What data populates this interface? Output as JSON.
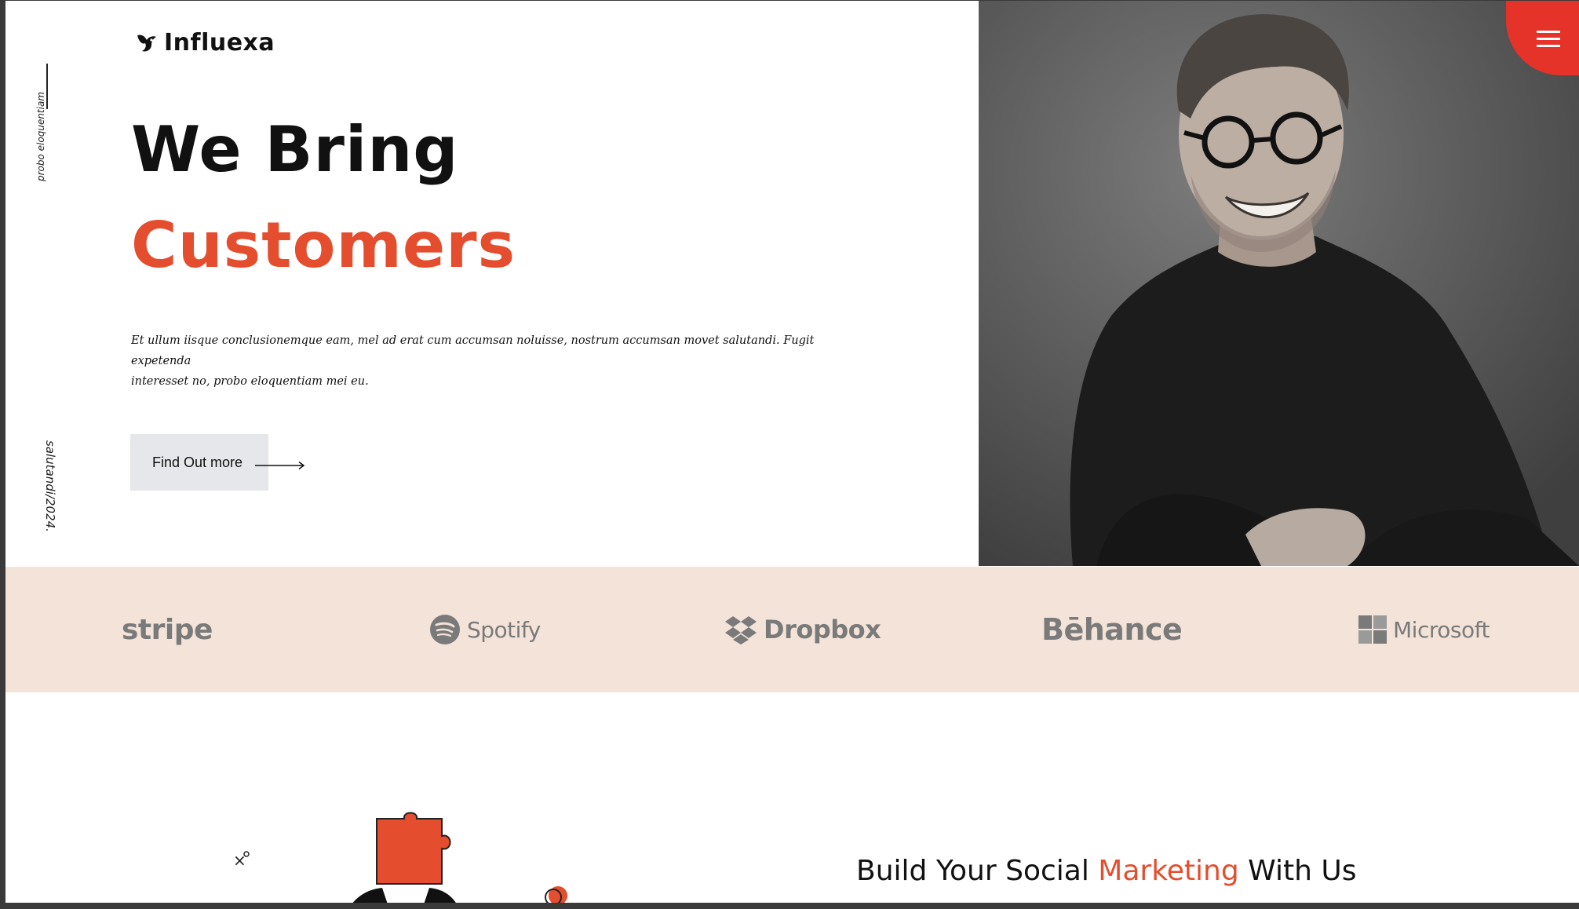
{
  "brand": {
    "name": "Influexa"
  },
  "side": {
    "top_text": "probo eloquentiam",
    "bottom_text": "salutandi/2024."
  },
  "hero": {
    "title_line1": "We Bring",
    "title_line2": "Customers",
    "description_line1": "Et ullum iisque conclusionemque eam, mel ad erat cum accumsan noluisse, nostrum accumsan movet salutandi. Fugit expetenda",
    "description_line2": "interesset no, probo eloquentiam mei eu.",
    "cta_label": "Find Out more"
  },
  "partners": [
    "stripe",
    "Spotify",
    "Dropbox",
    "Bēhance",
    "Microsoft"
  ],
  "section": {
    "title_part1": "Build Your Social ",
    "title_accent": "Marketing",
    "title_part2": " With Us"
  },
  "colors": {
    "accent": "#e44d2e",
    "menu": "#e6332a",
    "partners_bg": "#f3e3d9",
    "cta_bg": "#e6e7eb"
  },
  "icons": [
    "bird-logo-icon",
    "menu-icon",
    "arrow-right-icon",
    "spotify-logo-icon",
    "dropbox-logo-icon",
    "microsoft-logo-icon"
  ]
}
